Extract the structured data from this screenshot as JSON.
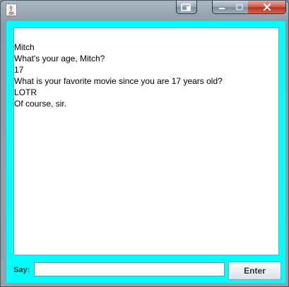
{
  "window": {
    "caption_buttons": [
      "window-switch-icon",
      "minimize-icon",
      "maximize-icon",
      "close-icon"
    ]
  },
  "chat": {
    "lines": [
      "Mitch",
      "What's your age, Mitch?",
      "17",
      "What is your favorite movie since you are 17 years old?",
      "LOTR",
      "Of course, sir."
    ]
  },
  "input": {
    "label": "Say:",
    "value": "",
    "placeholder": ""
  },
  "enter_button": {
    "label": "Enter"
  },
  "colors": {
    "client_background": "#00ffff",
    "chat_background": "#ffffff",
    "close_button": "#c7392b"
  }
}
